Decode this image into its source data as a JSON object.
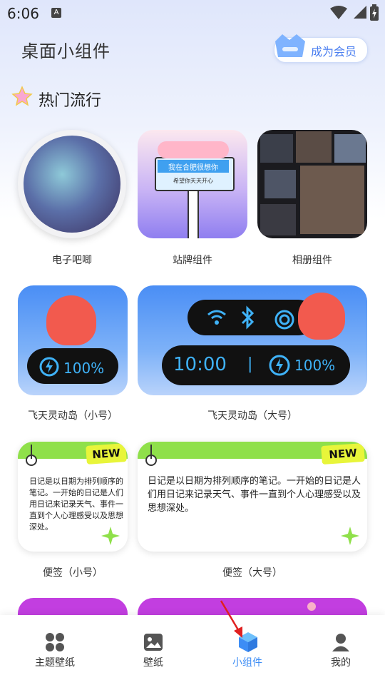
{
  "status_bar": {
    "time": "6:06",
    "notif_glyph": "A"
  },
  "header": {
    "title": "桌面小组件",
    "vip_label": "成为会员"
  },
  "section": {
    "title": "热门流行"
  },
  "widgets": {
    "badge": {
      "label": "电子吧唧"
    },
    "sign": {
      "label": "站牌组件",
      "board_text": "我在合肥很想你",
      "sub_text": "希望你天天开心"
    },
    "album": {
      "label": "相册组件"
    },
    "island_small": {
      "label": "飞天灵动岛（小号）",
      "battery": "100%"
    },
    "island_large": {
      "label": "飞天灵动岛（大号）",
      "clock": "10:00",
      "separator": "|",
      "battery": "100%"
    },
    "note_small": {
      "label": "便签（小号）",
      "new_tag": "NEW",
      "lines": [
        "日记是以日期为排列顺序的",
        "笔记。一开始的日记是人们",
        "用日记来记录天气、事件一",
        "直到个人心理感受以及思想",
        "深处。"
      ]
    },
    "note_large": {
      "label": "便签（大号）",
      "new_tag": "NEW",
      "lines": [
        "日记是以日期为排列顺序的笔记。一开始的日记是人",
        "们用日记来记录天气、事件一直到个人心理感受以及",
        "思想深处。"
      ]
    }
  },
  "nav": {
    "items": [
      {
        "label": "主题壁纸",
        "icon": "grid-icon"
      },
      {
        "label": "壁纸",
        "icon": "image-icon"
      },
      {
        "label": "小组件",
        "icon": "cube-icon",
        "active": true
      },
      {
        "label": "我的",
        "icon": "person-icon"
      }
    ]
  },
  "colors": {
    "accent": "#3d8df5",
    "note_green": "#8fe04a",
    "new_yellow": "#e8f53a",
    "island_blue": "#4a8ef5",
    "promo_purple": "#c23ee0"
  }
}
